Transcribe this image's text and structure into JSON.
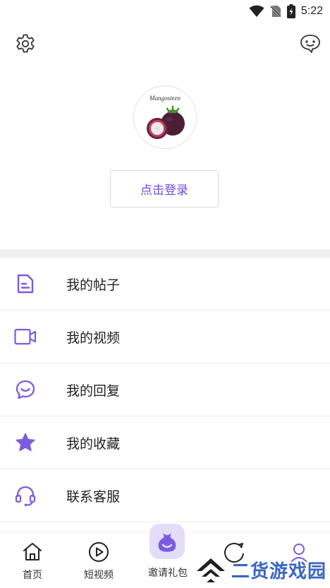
{
  "status": {
    "time": "5:22"
  },
  "profile": {
    "avatar_text": "Mangosteen",
    "login_label": "点击登录"
  },
  "menu": [
    {
      "label": "我的帖子",
      "icon": "document-icon"
    },
    {
      "label": "我的视频",
      "icon": "video-camera-icon"
    },
    {
      "label": "我的回复",
      "icon": "chat-bubble-icon"
    },
    {
      "label": "我的收藏",
      "icon": "star-icon"
    },
    {
      "label": "联系客服",
      "icon": "headset-icon"
    }
  ],
  "tabs": [
    {
      "label": "首页",
      "icon": "home-icon"
    },
    {
      "label": "短视频",
      "icon": "play-circle-icon"
    },
    {
      "label": "邀请礼包",
      "icon": "gift-bag-icon"
    },
    {
      "label": "",
      "icon": "compass-icon"
    },
    {
      "label": "",
      "icon": "user-icon"
    }
  ],
  "watermark": {
    "text": "二货游戏园"
  },
  "colors": {
    "accent": "#6b4fd8",
    "icon_purple": "#7a5ce0",
    "divider": "#f0f0f0"
  }
}
